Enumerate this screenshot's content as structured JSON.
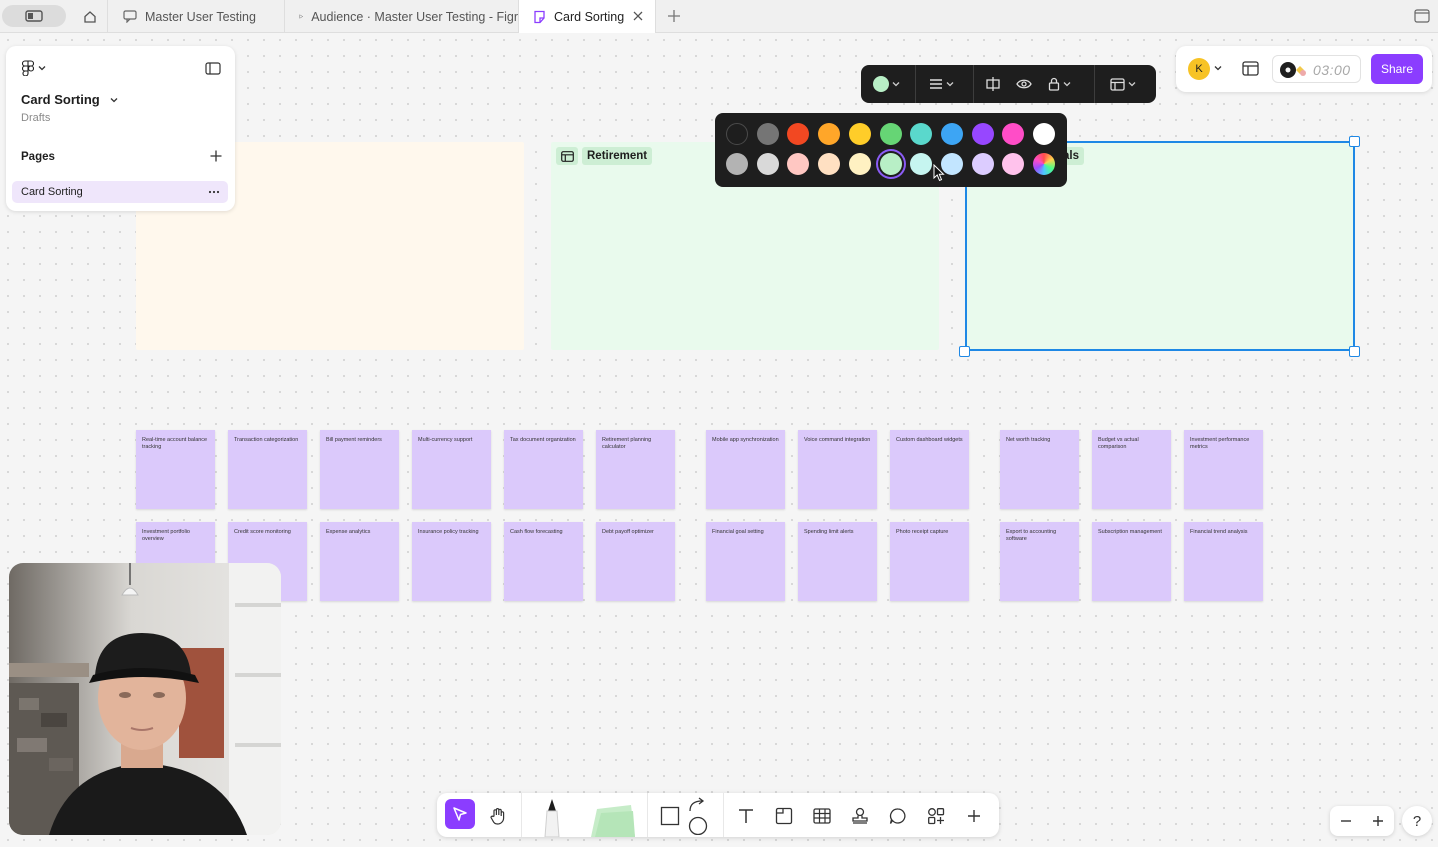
{
  "tabs": [
    {
      "label": "Master User Testing",
      "icon": "comment-board-icon"
    },
    {
      "label": "Audience · Master User Testing - Figr",
      "icon": "play-icon"
    },
    {
      "label": "Card Sorting",
      "icon": "figjam-file-icon",
      "active": true
    }
  ],
  "left_panel": {
    "file_name": "Card Sorting",
    "location": "Drafts",
    "pages_title": "Pages",
    "pages": [
      {
        "label": "Card Sorting",
        "active": true
      }
    ]
  },
  "sections": [
    {
      "title": ""
    },
    {
      "title": "Retirement"
    },
    {
      "title_visible": "als"
    }
  ],
  "stickies": [
    "Real-time account balance tracking",
    "Transaction categorization",
    "Bill payment reminders",
    "Multi-currency support",
    "Tax document organization",
    "Retirement planning calculator",
    "Mobile app synchronization",
    "Voice command integration",
    "Custom dashboard widgets",
    "Net worth tracking",
    "Budget vs actual comparison",
    "Investment performance metrics",
    "Investment portfolio overview",
    "Credit score monitoring",
    "Expense analytics",
    "Insurance policy tracking",
    "Cash flow forecasting",
    "Debt payoff optimizer",
    "Financial goal setting",
    "Spending limit alerts",
    "Photo receipt capture",
    "Export to accounting software",
    "Subscription management",
    "Financial trend analysis"
  ],
  "colors": {
    "accent": "#8b3dff",
    "selection": "#1e88e5",
    "sticky": "#dbc9fb",
    "section_green": "#e9faed",
    "section_cream": "#fff8ed",
    "current_fill": "#b8efc6"
  },
  "palette": {
    "row1": [
      "#1e1e1e",
      "#757575",
      "#f24822",
      "#ffa629",
      "#ffcd29",
      "#66d575",
      "#5ad8cc",
      "#3da5f4",
      "#9747ff",
      "#ff4dc7",
      "#ffffff"
    ],
    "row2": [
      "#b3b3b3",
      "#d9d9d9",
      "#ffc7c2",
      "#ffe0c2",
      "#fff1c2",
      "#b8efc6",
      "#c6f5f0",
      "#c2e5ff",
      "#dcccff",
      "#ffc2ec",
      "rainbow"
    ],
    "selected": "#b8efc6"
  },
  "top_right": {
    "avatar_initial": "K",
    "timer": "03:00",
    "share_label": "Share"
  },
  "webcam": {
    "description_icon": "presenter-webcam"
  }
}
